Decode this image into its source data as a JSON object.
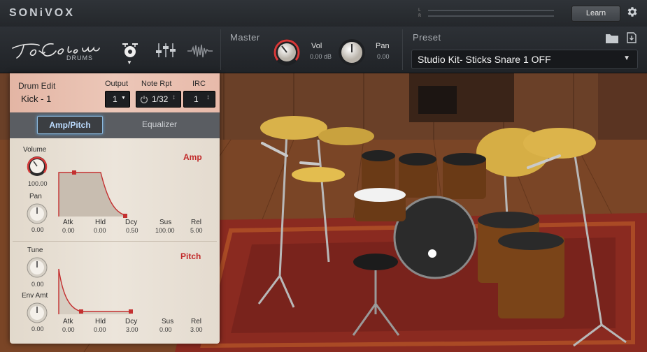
{
  "topbar": {
    "brand": "SONiVOX",
    "meter_labels": [
      "L",
      "R"
    ],
    "learn_label": "Learn",
    "settings_icon": "gear-icon"
  },
  "header": {
    "logo_text": "DRUMS",
    "master": {
      "label": "Master",
      "vol_label": "Vol",
      "vol_value": "0.00 dB",
      "pan_label": "Pan",
      "pan_value": "0.00"
    },
    "preset": {
      "label": "Preset",
      "selected": "Studio Kit- Sticks Snare 1 OFF"
    }
  },
  "drum_edit": {
    "title": "Drum Edit",
    "drum": "Kick - 1",
    "output_label": "Output",
    "output_value": "1",
    "note_rpt_label": "Note Rpt",
    "note_rpt_value": "1/32",
    "irc_label": "IRC",
    "irc_value": "1",
    "tabs": [
      "Amp/Pitch",
      "Equalizer"
    ],
    "active_tab": "Amp/Pitch"
  },
  "amp": {
    "title": "Amp",
    "volume_label": "Volume",
    "volume_value": "100.00",
    "pan_label": "Pan",
    "pan_value": "0.00",
    "envelope": [
      {
        "label": "Atk",
        "value": "0.00"
      },
      {
        "label": "Hld",
        "value": "0.00"
      },
      {
        "label": "Dcy",
        "value": "0.50"
      },
      {
        "label": "Sus",
        "value": "100.00"
      },
      {
        "label": "Rel",
        "value": "5.00"
      }
    ]
  },
  "pitch": {
    "title": "Pitch",
    "tune_label": "Tune",
    "tune_value": "0.00",
    "env_amt_label": "Env Amt",
    "env_amt_value": "0.00",
    "envelope": [
      {
        "label": "Atk",
        "value": "0.00"
      },
      {
        "label": "Hld",
        "value": "0.00"
      },
      {
        "label": "Dcy",
        "value": "3.00"
      },
      {
        "label": "Sus",
        "value": "0.00"
      },
      {
        "label": "Rel",
        "value": "3.00"
      }
    ]
  },
  "colors": {
    "accent_red": "#c22a2a",
    "active_tab_glow": "#5fa5dc"
  }
}
